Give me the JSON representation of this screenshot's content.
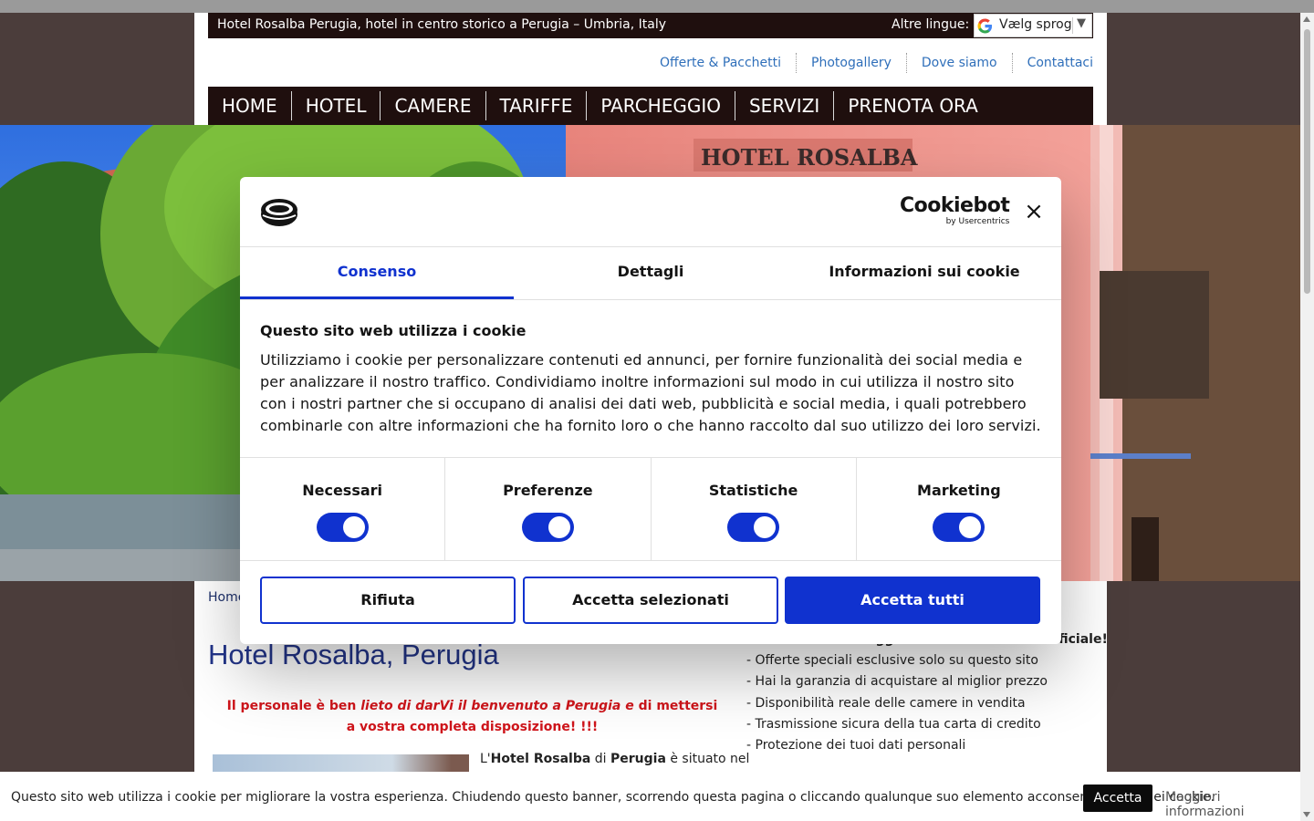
{
  "header": {
    "title": "Hotel Rosalba Perugia, hotel in centro storico a Perugia – Umbria, Italy",
    "altre_lingue": "Altre lingue:",
    "language_select": "Vælg sprog",
    "language_arrow": "▼"
  },
  "util_nav": [
    "Offerte & Pacchetti",
    "Photogallery",
    "Dove siamo",
    "Contattaci"
  ],
  "main_nav": [
    "HOME",
    "HOTEL",
    "CAMERE",
    "TARIFFE",
    "PARCHEGGIO",
    "SERVIZI",
    "PRENOTA ORA"
  ],
  "hero": {
    "sign_text": "HOTEL ROSALBA"
  },
  "content": {
    "breadcrumb": "Home",
    "title": "Hotel Rosalba, Perugia",
    "welcome_a": "Il personale è ben ",
    "welcome_b": "lieto di darVi il benvenuto a Perugia e",
    "welcome_c": " di mettersi a vostra completa disposizione! !!!",
    "intro_a": "L'",
    "intro_b": "Hotel Rosalba",
    "intro_c": " di ",
    "intro_d": "Perugia",
    "intro_e": " è situato nel"
  },
  "benefits": [
    "- Prenota il tuo soggiorno sul nostro sito Ufficiale!",
    "- Offerte speciali esclusive solo su questo sito",
    "- Hai la garanzia di acquistare al miglior prezzo",
    "- Disponibilità reale delle camere in vendita",
    "- Trasmissione sicura della tua carta di credito",
    "- Protezione dei tuoi dati personali"
  ],
  "cookie_dialog": {
    "brand": "Cookiebot",
    "brand_by": "by Usercentrics",
    "close": "×",
    "tabs": [
      "Consenso",
      "Dettagli",
      "Informazioni sui cookie"
    ],
    "heading": "Questo sito web utilizza i cookie",
    "body": "Utilizziamo i cookie per personalizzare contenuti ed annunci, per fornire funzionalità dei social media e per analizzare il nostro traffico. Condividiamo inoltre informazioni sul modo in cui utilizza il nostro sito con i nostri partner che si occupano di analisi dei dati web, pubblicità e social media, i quali potrebbero combinarle con altre informazioni che ha fornito loro o che hanno raccolto dal suo utilizzo dei loro servizi.",
    "categories": [
      {
        "label": "Necessari",
        "enabled": true
      },
      {
        "label": "Preferenze",
        "enabled": true
      },
      {
        "label": "Statistiche",
        "enabled": true
      },
      {
        "label": "Marketing",
        "enabled": true
      }
    ],
    "buttons": {
      "reject": "Rifiuta",
      "accept_selected": "Accetta selezionati",
      "accept_all": "Accetta tutti"
    },
    "accent": "#1032cf"
  },
  "bottom_banner": {
    "text": "Questo sito web utilizza i cookie per migliorare la vostra esperienza. Chiudendo questo banner, scorrendo questa pagina o cliccando qualunque suo elemento acconsenti all'uso dei cookie.",
    "accept": "Accetta",
    "more": "Maggiori informazioni"
  }
}
